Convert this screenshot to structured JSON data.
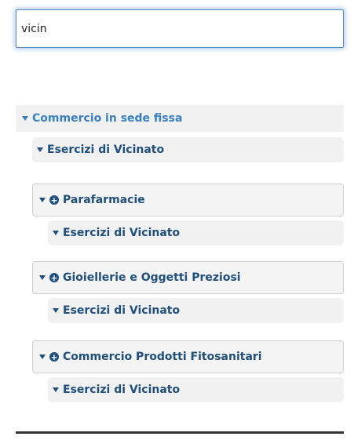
{
  "search": {
    "value": "vicin"
  },
  "tree": {
    "root": {
      "label": "Commercio in sede fissa",
      "child_label": "Esercizi di Vicinato"
    },
    "groups": [
      {
        "label": "Parafarmacie",
        "child_label": "Esercizi di Vicinato"
      },
      {
        "label": "Gioiellerie e Oggetti Preziosi",
        "child_label": "Esercizi di Vicinato"
      },
      {
        "label": "Commercio Prodotti Fitosanitari",
        "child_label": "Esercizi di Vicinato"
      }
    ]
  },
  "colors": {
    "accent": "#3a7fc1",
    "text_dark_blue": "#1f4f7a",
    "row_background": "#f1f1f1",
    "border": "#cfcfcf",
    "input_focus": "#5b87b8"
  },
  "icons": {
    "expand": "caret-down-icon",
    "add": "plus-circle-icon"
  }
}
